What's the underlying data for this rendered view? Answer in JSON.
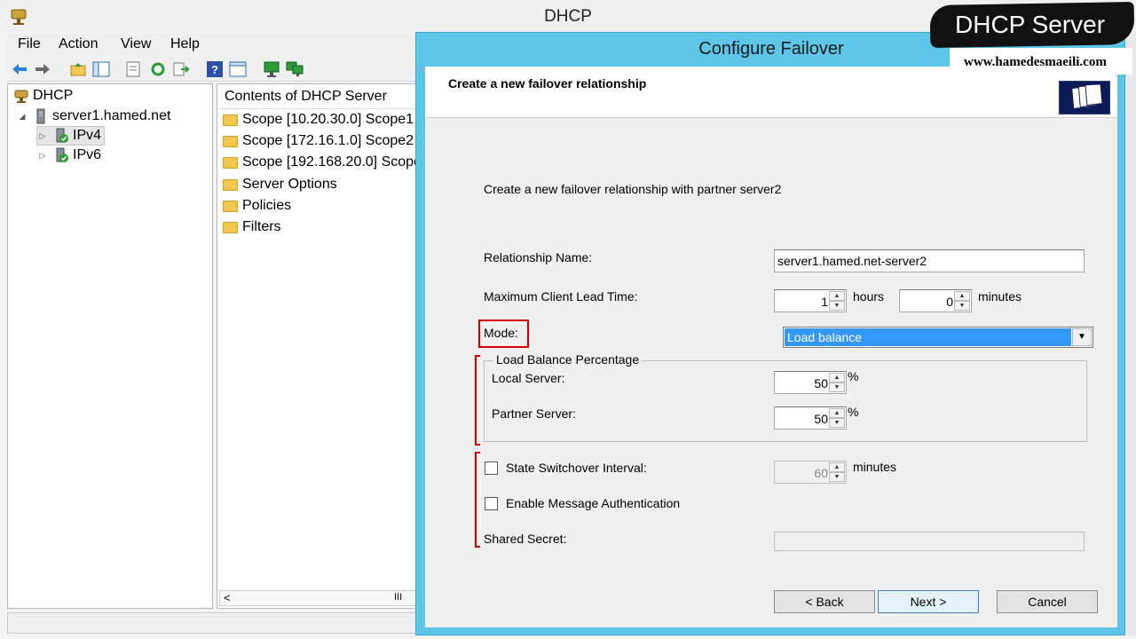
{
  "app": {
    "title": "DHCP",
    "menu": [
      "File",
      "Action",
      "View",
      "Help"
    ]
  },
  "tree": {
    "root": "DHCP",
    "server": "server1.hamed.net",
    "ipv4": "IPv4",
    "ipv6": "IPv6"
  },
  "contents": {
    "header": "Contents of DHCP Server",
    "items": [
      "Scope [10.20.30.0] Scope1",
      "Scope [172.16.1.0] Scope2",
      "Scope [192.168.20.0] Scope3",
      "Server Options",
      "Policies",
      "Filters"
    ],
    "scroll_grip": "III"
  },
  "dialog": {
    "title": "Configure Failover",
    "header": "Create a new failover relationship",
    "intro": "Create a new failover relationship with partner server2",
    "relationship_name_label": "Relationship Name:",
    "relationship_name_value": "server1.hamed.net-server2",
    "mclt_label": "Maximum Client Lead Time:",
    "mclt_hours": "1",
    "hours_label": "hours",
    "mclt_minutes": "0",
    "minutes_label": "minutes",
    "mode_label": "Mode:",
    "mode_value": "Load balance",
    "lb_group_title": "Load Balance Percentage",
    "local_server_label": "Local Server:",
    "local_server_value": "50",
    "partner_server_label": "Partner Server:",
    "partner_server_value": "50",
    "percent": "%",
    "switchover_label": "State Switchover Interval:",
    "switchover_value": "60",
    "switchover_unit": "minutes",
    "auth_label": "Enable Message Authentication",
    "shared_secret_label": "Shared Secret:",
    "shared_secret_value": "",
    "back_button": "< Back",
    "next_button": "Next >",
    "cancel_button": "Cancel"
  },
  "watermark": {
    "title": "DHCP Server",
    "site": "www.hamedesmaeili.com"
  },
  "colors": {
    "dialog_frame": "#5cc5e8",
    "selection": "#3399ff",
    "annotation_red": "#d40000"
  }
}
